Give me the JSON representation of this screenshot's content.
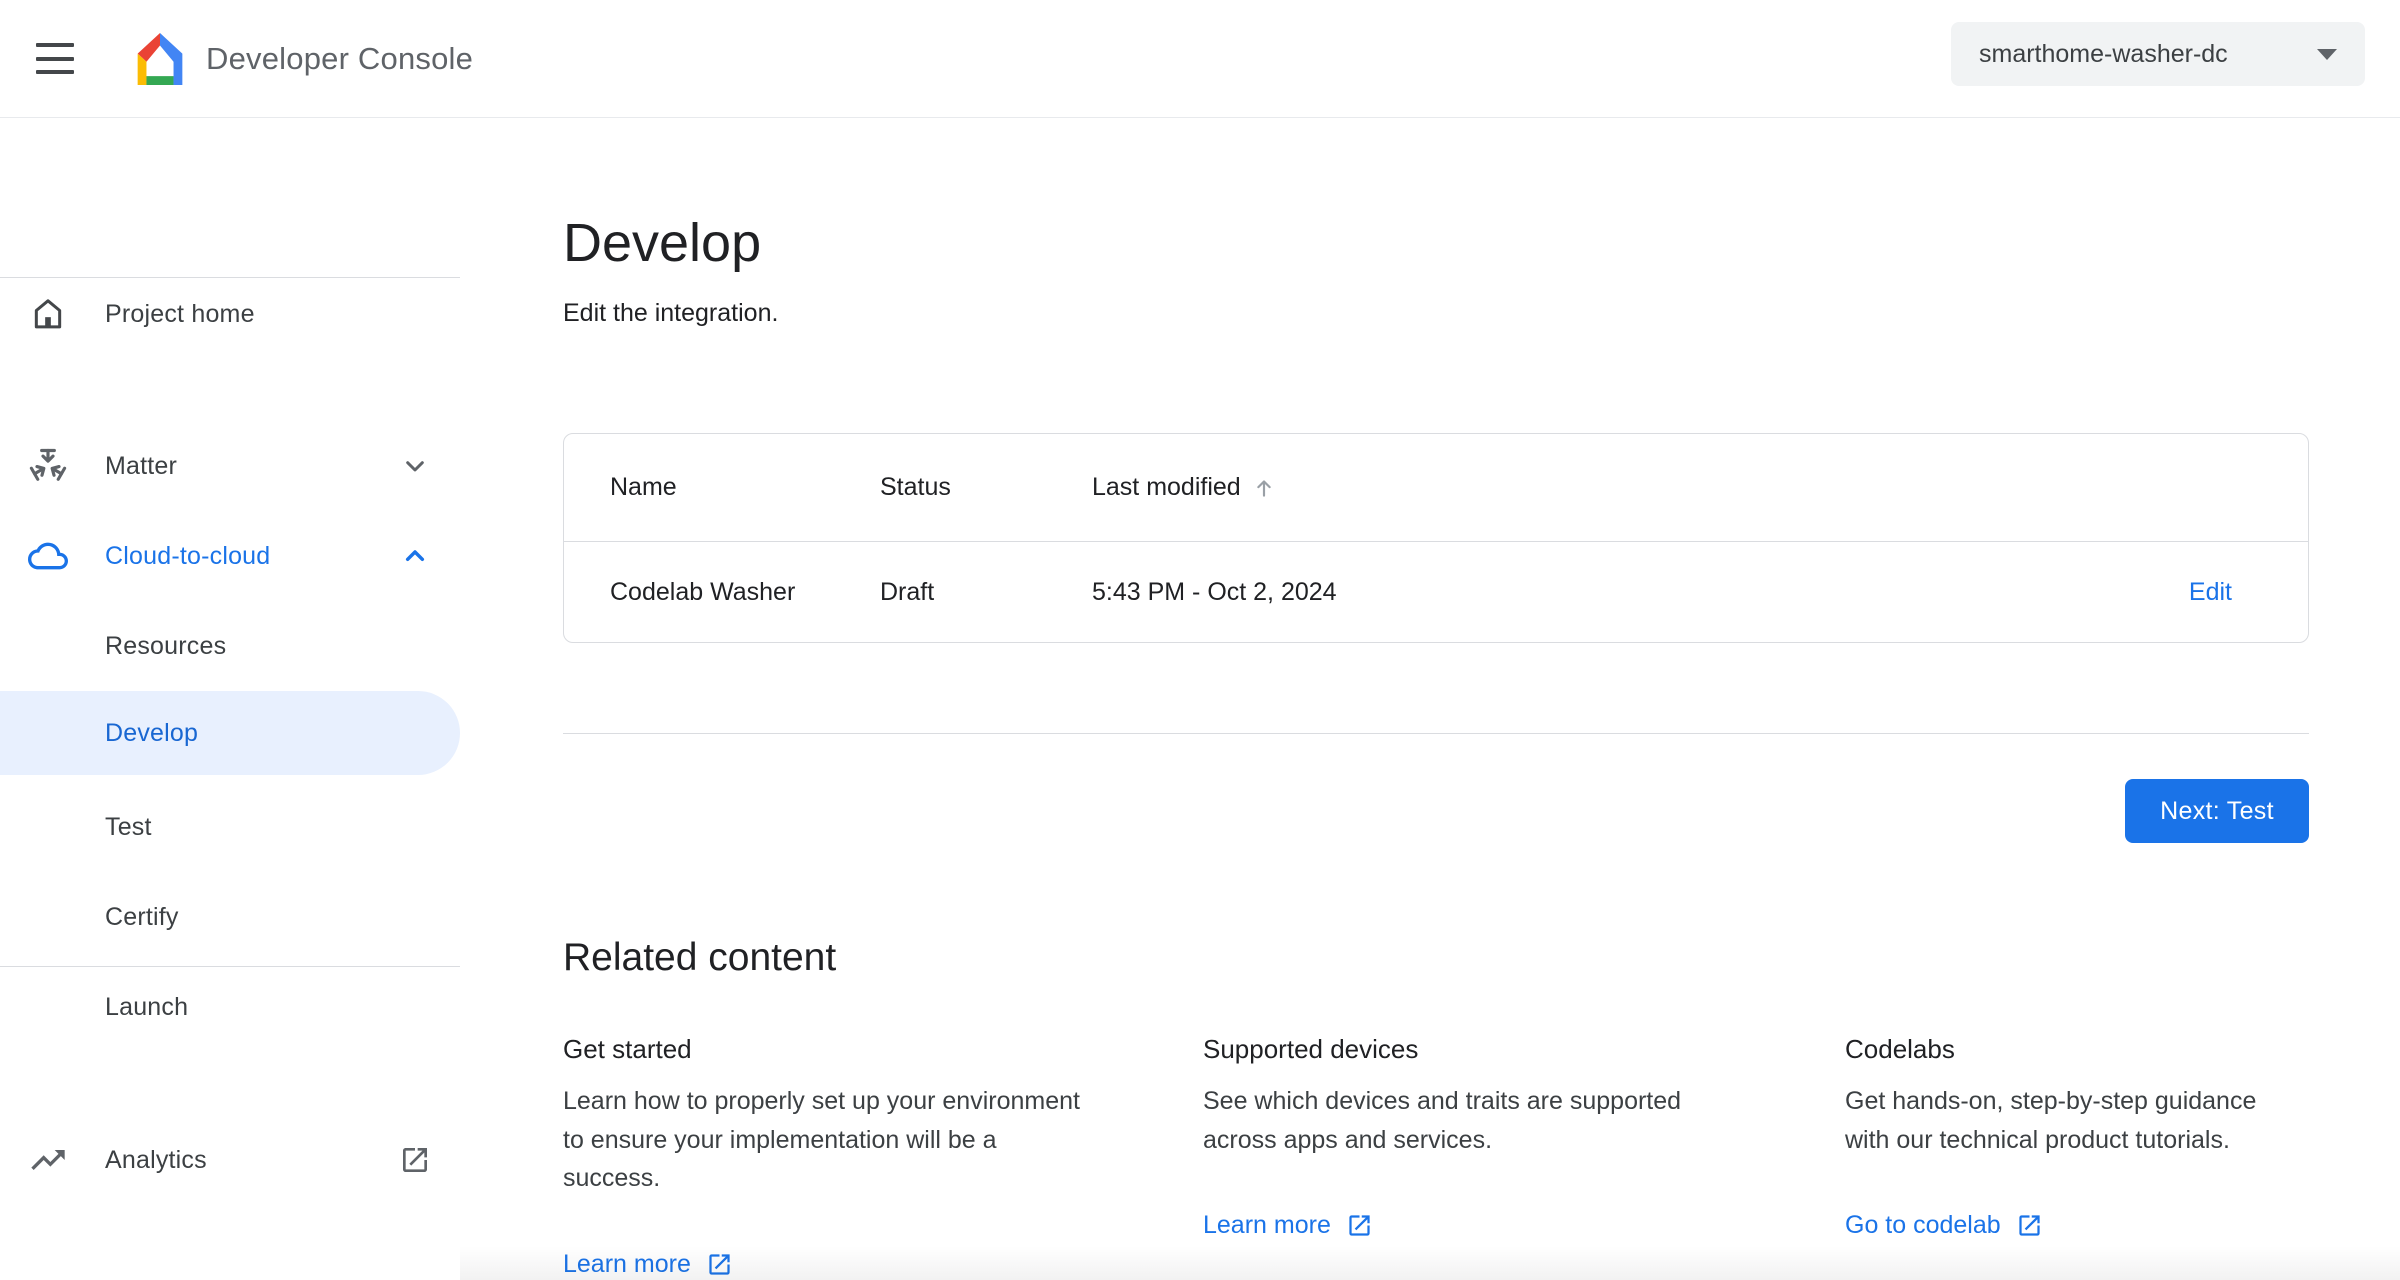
{
  "header": {
    "app_title": "Developer Console",
    "project_selector": {
      "value": "smarthome-washer-dc"
    }
  },
  "sidebar": {
    "project_home": "Project home",
    "matter": "Matter",
    "cloud_to_cloud": "Cloud-to-cloud",
    "resources": "Resources",
    "develop": "Develop",
    "test": "Test",
    "certify": "Certify",
    "launch": "Launch",
    "analytics": "Analytics"
  },
  "main": {
    "title": "Develop",
    "subtitle": "Edit the integration.",
    "table": {
      "columns": [
        "Name",
        "Status",
        "Last modified"
      ],
      "sort_column": "Last modified",
      "sort_direction": "ascending",
      "rows": [
        {
          "name": "Codelab Washer",
          "status": "Draft",
          "last_modified": "5:43 PM - Oct 2, 2024",
          "action": "Edit"
        }
      ]
    },
    "next_button_label": "Next: Test",
    "related": {
      "title": "Related content",
      "cards": [
        {
          "title": "Get started",
          "body": "Learn how to properly set up your environment to ensure your implementation will be a success.",
          "link_label": "Learn more"
        },
        {
          "title": "Supported devices",
          "body": "See which devices and traits are supported across apps and services.",
          "link_label": "Learn more"
        },
        {
          "title": "Codelabs",
          "body": "Get hands-on, step-by-step guidance with our technical product tutorials.",
          "link_label": "Go to codelab"
        }
      ]
    }
  },
  "colors": {
    "accent_blue": "#1a73e8",
    "selected_nav_text": "#1967d2",
    "selected_nav_bg": "#e8f0fe",
    "logo_red": "#ea4335",
    "logo_blue": "#4285f4",
    "logo_yellow": "#fbbc04",
    "logo_green": "#34a853"
  }
}
